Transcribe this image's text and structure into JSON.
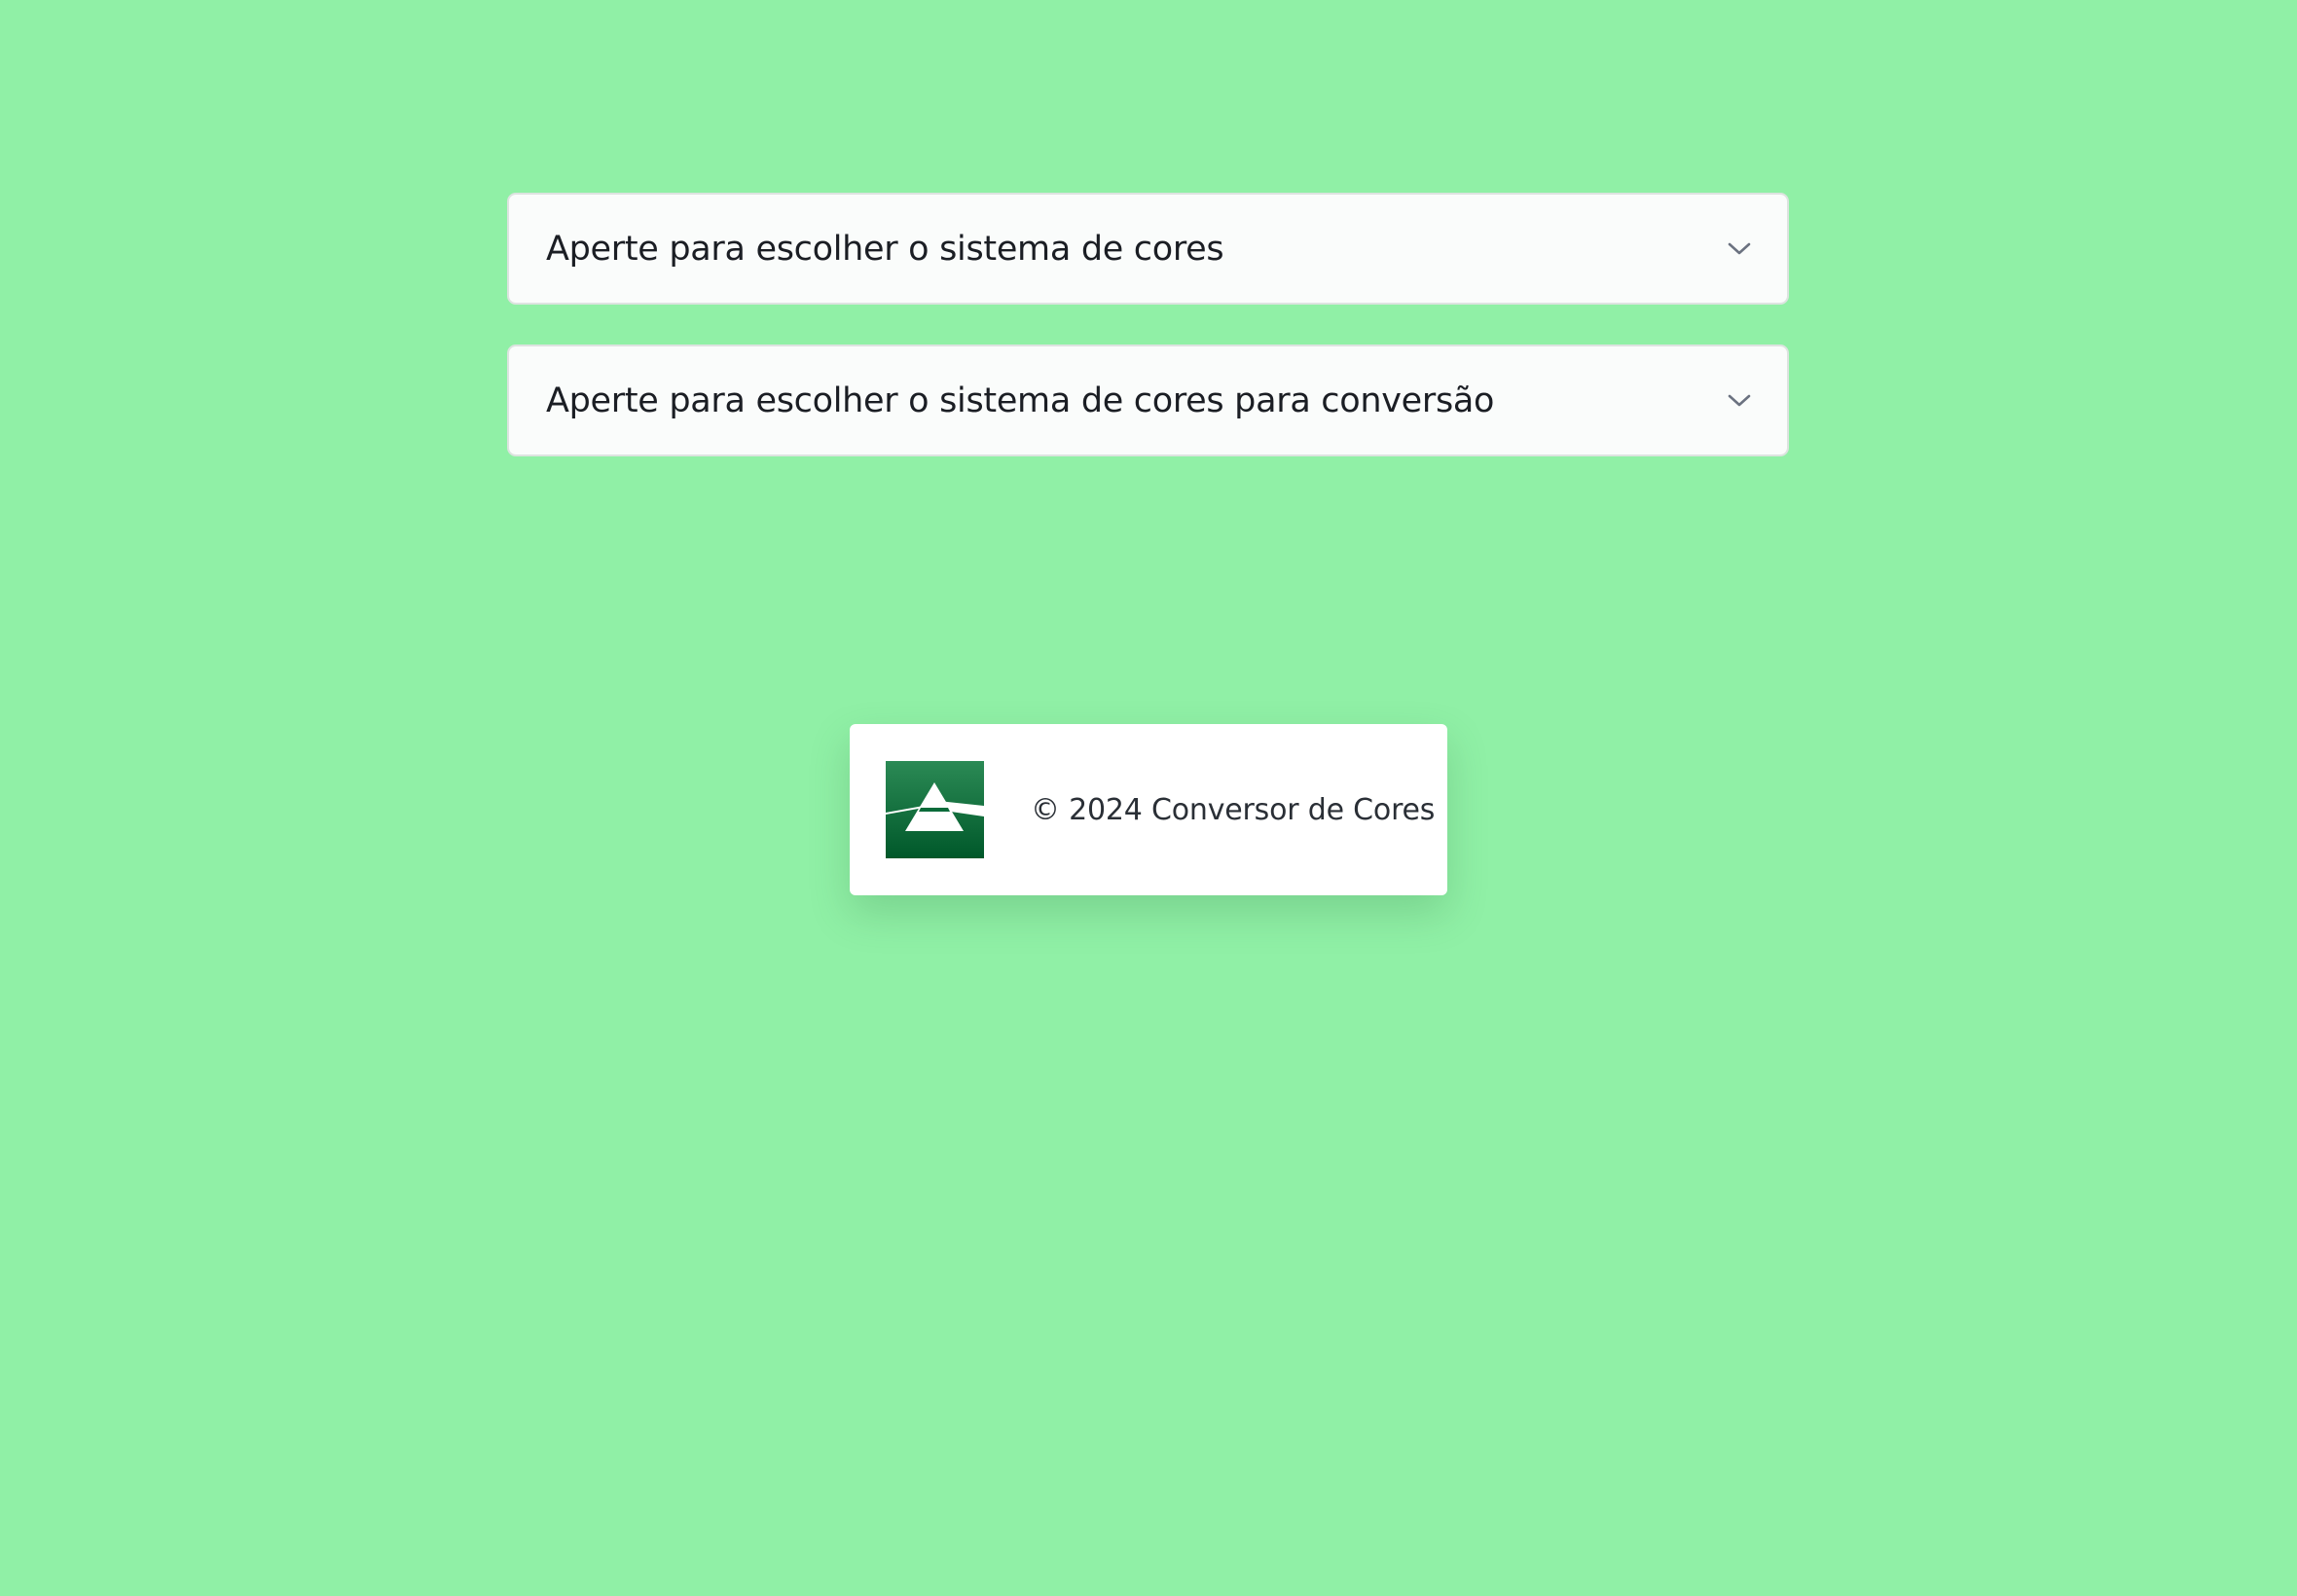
{
  "selectors": {
    "source": {
      "label": "Aperte para escolher o sistema de cores",
      "icon": "chevron-down-icon"
    },
    "target": {
      "label": "Aperte para escolher o sistema de cores para conversão",
      "icon": "chevron-down-icon"
    }
  },
  "footer": {
    "text": "© 2024 Conversor de Cores",
    "logo_icon": "prism-logo-icon"
  },
  "colors": {
    "background": "#90f0a6",
    "select_background": "#fafcfb",
    "logo_green": "#0a6b3a"
  }
}
